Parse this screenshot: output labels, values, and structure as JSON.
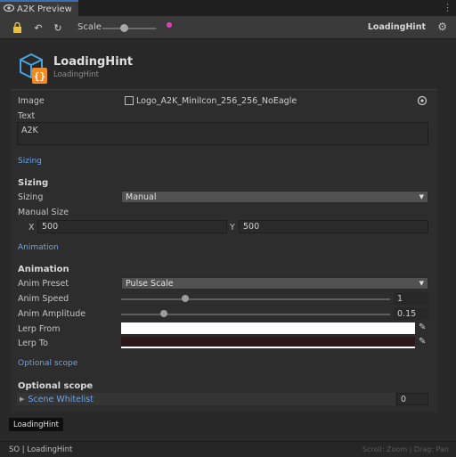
{
  "window": {
    "tab_title": "A2K Preview"
  },
  "toolbar": {
    "scale_label": "Scale",
    "title": "LoadingHint",
    "scale_value": 0.4
  },
  "header": {
    "title": "LoadingHint",
    "subtitle": "LoadingHint"
  },
  "fields": {
    "image": {
      "label": "Image",
      "value": "Logo_A2K_MiniIcon_256_256_NoEagle"
    },
    "text": {
      "label": "Text",
      "value": "A2K"
    },
    "sizing_link": "Sizing",
    "sizing_head": "Sizing",
    "sizing": {
      "label": "Sizing",
      "value": "Manual"
    },
    "manual_size": {
      "label": "Manual Size",
      "x_label": "X",
      "x_value": "500",
      "y_label": "Y",
      "y_value": "500"
    },
    "animation_link": "Animation",
    "animation_head": "Animation",
    "anim_preset": {
      "label": "Anim Preset",
      "value": "Pulse Scale"
    },
    "anim_speed": {
      "label": "Anim Speed",
      "value": "1",
      "fraction": 0.24
    },
    "anim_amplitude": {
      "label": "Anim Amplitude",
      "value": "0.15",
      "fraction": 0.16
    },
    "lerp_from": {
      "label": "Lerp From",
      "color": "#ffffff"
    },
    "lerp_to": {
      "label": "Lerp To",
      "color": "#2a1a1a"
    },
    "optional_link": "Optional scope",
    "optional_head": "Optional scope",
    "scene_whitelist": {
      "label": "Scene Whitelist",
      "value": "0"
    }
  },
  "footer_tag": "LoadingHint",
  "status": {
    "left": "SO | LoadingHint",
    "right": "Scroll: Zoom | Drag: Pan"
  },
  "colors": {
    "accent": "#3c6fb6",
    "link": "#6ea4e4",
    "icon_blue": "#4aa3df",
    "icon_orange": "#f08a24"
  },
  "icons": [
    "eye-icon",
    "lock-icon",
    "undo-icon",
    "refresh-icon",
    "gear-icon",
    "target-icon",
    "eyedropper-icon",
    "triangle-right-icon",
    "chevron-down-icon",
    "kebab-icon"
  ]
}
